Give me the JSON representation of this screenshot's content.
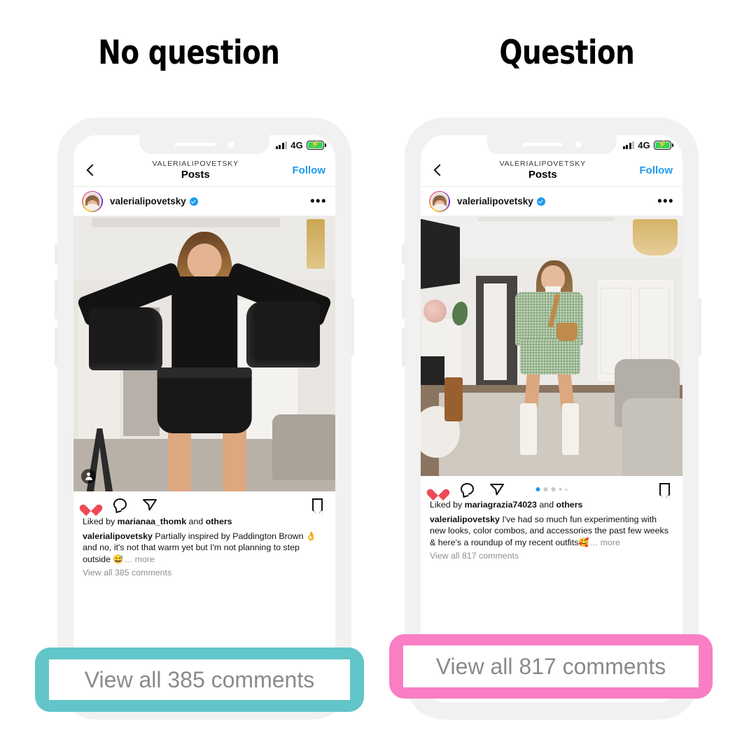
{
  "headings": {
    "left": "No question",
    "right": "Question"
  },
  "phones": [
    {
      "id": "left",
      "status_bar": {
        "network": "4G",
        "battery_state": "charging",
        "bolt": "⚡"
      },
      "app_header": {
        "back_icon": "chevron-left-icon",
        "handle": "VALERIALIPOVETSKY",
        "title": "Posts",
        "follow_label": "Follow"
      },
      "post": {
        "username": "valerialipovetsky",
        "verified": true,
        "more_menu": "•••",
        "media_alt": "Woman in black turtleneck and leather shorts holding black chunky boots",
        "tag_badge": "person-tag-icon",
        "actions": {
          "like": "heart-filled-icon",
          "comment": "comment-bubble-icon",
          "share": "paper-plane-icon",
          "save": "bookmark-icon"
        },
        "liked_by_prefix": "Liked by",
        "liked_by_user": "marianaa_thomk",
        "liked_by_suffix": "and",
        "liked_by_others": "others",
        "caption_user": "valerialipovetsky",
        "caption_text": "Partially inspired by Paddington Brown 👌 and no, it's not that warm yet but I'm not planning to step outside 😅",
        "caption_more": "… more",
        "view_comments": "View all 385 comments"
      },
      "callout": {
        "text": "View all 385 comments",
        "color": "#62c5c9"
      }
    },
    {
      "id": "right",
      "status_bar": {
        "network": "4G",
        "battery_state": "charging",
        "bolt": "⚡"
      },
      "app_header": {
        "back_icon": "chevron-left-icon",
        "handle": "VALERIALIPOVETSKY",
        "title": "Posts",
        "follow_label": "Follow"
      },
      "post": {
        "username": "valerialipovetsky",
        "verified": true,
        "more_menu": "•••",
        "media_alt": "Woman in mint green tweed jacket and skirt set with white knee-high boots in a living room",
        "carousel_dots": 5,
        "carousel_active_index": 0,
        "actions": {
          "like": "heart-filled-icon",
          "comment": "comment-bubble-icon",
          "share": "paper-plane-icon",
          "save": "bookmark-icon"
        },
        "liked_by_prefix": "Liked by",
        "liked_by_user": "mariagrazia74023",
        "liked_by_suffix": "and",
        "liked_by_others": "others",
        "caption_user": "valerialipovetsky",
        "caption_text": "I've had so much fun experimenting with new looks, color combos, and accessories the past few weeks & here's a roundup of my recent outfits🥰",
        "caption_more": "… more",
        "view_comments": "View all 817 comments"
      },
      "callout": {
        "text": "View all 817 comments",
        "color": "#f97ec4"
      }
    }
  ],
  "colors": {
    "background": "#ffffff",
    "phone_frame": "#f1f1f1",
    "instagram_blue": "#1c9bf0",
    "heart_red": "#ed4956",
    "muted_text": "#8e8e8e",
    "callout_teal": "#62c5c9",
    "callout_pink": "#f97ec4",
    "battery_green": "#3ad15a"
  }
}
